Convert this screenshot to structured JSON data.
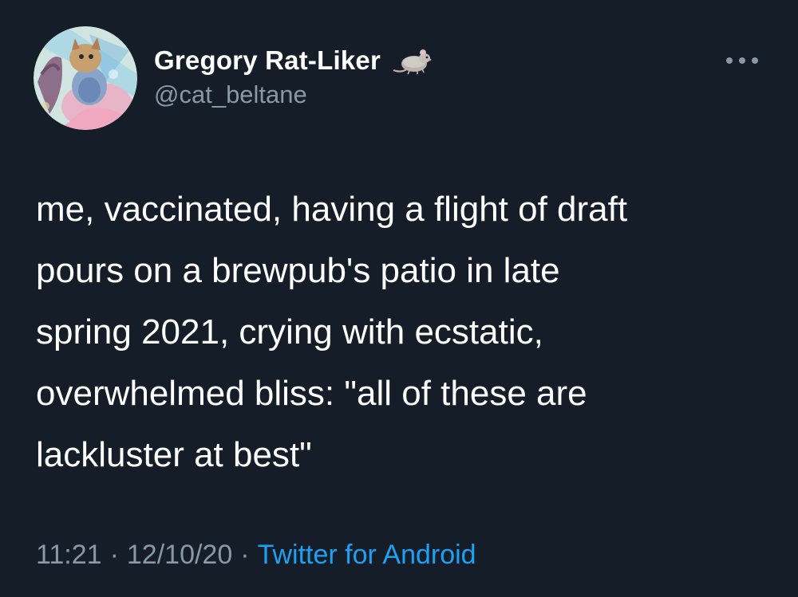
{
  "tweet": {
    "author": {
      "display_name": "Gregory Rat-Liker",
      "name_emoji": "rat-emoji",
      "handle": "@cat_beltane"
    },
    "more_icon": "more-horizontal-icon",
    "text": "me, vaccinated, having a flight of draft\npours on a brewpub's patio in late\nspring 2021, crying with ecstatic,\noverwhelmed bliss: \"all of these are\nlackluster at best\"",
    "time": "11:21",
    "separator": "·",
    "date": "12/10/20",
    "source": "Twitter for Android"
  },
  "colors": {
    "background": "#151d29",
    "primary_text": "#ffffff",
    "secondary_text": "#8899a6",
    "link": "#1da1f2"
  }
}
